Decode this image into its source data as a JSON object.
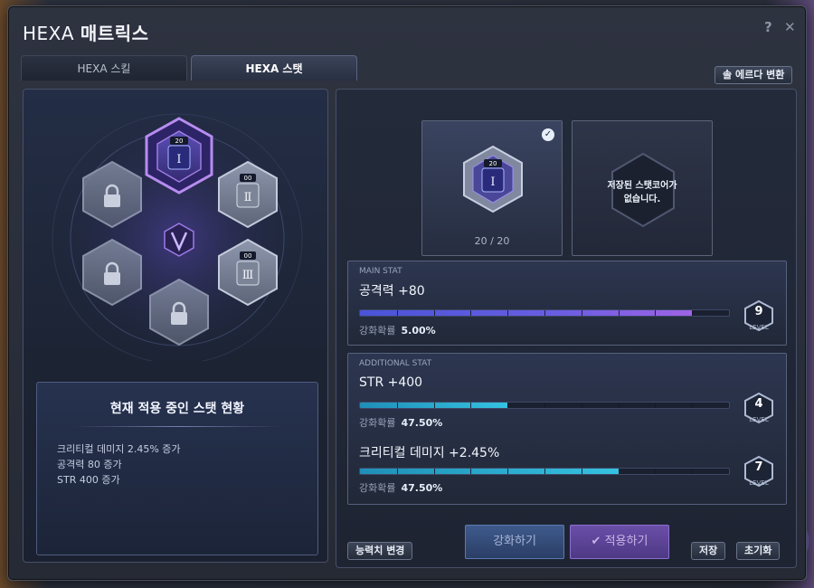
{
  "window": {
    "title_prefix": "HEXA",
    "title_main": "매트릭스",
    "help": "?",
    "close": "✕"
  },
  "tabs": [
    {
      "label": "HEXA 스킬",
      "active": false
    },
    {
      "label": "HEXA 스탯",
      "active": true
    }
  ],
  "header_button": "솔 에르다 변환",
  "hex_nodes": {
    "active_badge": "20",
    "node_2_label": "Ⅱ",
    "node_2_badge": "00",
    "node_3_label": "Ⅲ",
    "node_3_badge": "00",
    "active_label": "Ⅰ"
  },
  "status_panel": {
    "title": "현재 적용 중인 스탯 현황",
    "lines": [
      "크리티컬 데미지 2.45% 증가",
      "공격력 80 증가",
      "STR 400 증가"
    ]
  },
  "slots": {
    "current_badge": "20",
    "current_label": "Ⅰ",
    "current_count": "20 / 20",
    "empty_line1": "저장된 스탯코어가",
    "empty_line2": "없습니다."
  },
  "main_stat": {
    "label": "MAIN STAT",
    "name": "공격력 +80",
    "prob_label": "강화확률",
    "prob_value": "5.00%",
    "level": "9",
    "level_caption": "LEVEL",
    "level_fraction": 0.9
  },
  "additional_stat": {
    "label": "ADDITIONAL STAT",
    "items": [
      {
        "name": "STR +400",
        "prob_label": "강화확률",
        "prob_value": "47.50%",
        "level": "4",
        "level_caption": "LEVEL",
        "level_fraction": 0.4
      },
      {
        "name": "크리티컬 데미지 +2.45%",
        "prob_label": "강화확률",
        "prob_value": "47.50%",
        "level": "7",
        "level_caption": "LEVEL",
        "level_fraction": 0.7
      }
    ]
  },
  "buttons": {
    "ability_change": "능력치 변경",
    "enhance": "강화하기",
    "apply": "적용하기",
    "save": "저장",
    "reset": "초기화"
  },
  "colors": {
    "accent_purple": "#8b6fd0",
    "accent_cyan": "#35c2e0",
    "panel_border": "#48506a"
  }
}
